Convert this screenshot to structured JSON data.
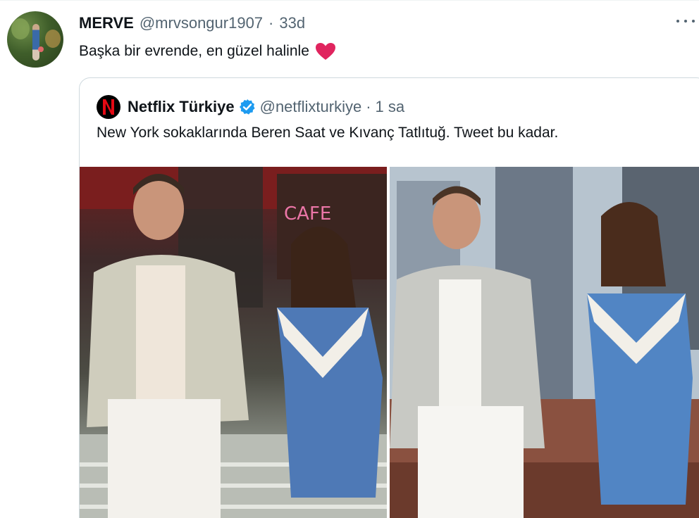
{
  "tweet": {
    "display_name": "MERVE",
    "handle": "@mrvsongur1907",
    "separator": "·",
    "time": "33d",
    "text": "Başka bir evrende, en güzel halinle",
    "emoji_icon": "red-heart-icon",
    "more_icon": "more-dots-icon"
  },
  "quote": {
    "display_name": "Netflix Türkiye",
    "verified_icon": "verified-badge-icon",
    "handle": "@netflixturkiye",
    "separator": "·",
    "time": "1 sa",
    "text": "New York sokaklarında Beren Saat ve Kıvanç Tatlıtuğ. Tweet bu kadar.",
    "avatar_letter": "N",
    "media": [
      {
        "kind": "photo"
      },
      {
        "kind": "photo"
      }
    ]
  },
  "colors": {
    "text": "#0f1419",
    "muted": "#536471",
    "border": "#cfd9de",
    "heart": "#e0245e",
    "verified": "#1d9bf0",
    "netflix_red": "#e50914"
  }
}
